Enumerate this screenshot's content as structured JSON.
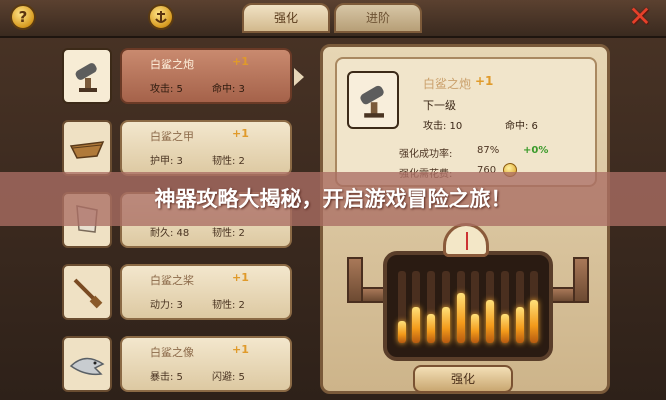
{
  "topbar": {
    "help_icon": "?",
    "tabs": [
      {
        "label": "强化",
        "active": true
      },
      {
        "label": "进阶",
        "active": false
      }
    ],
    "close_icon": "✕"
  },
  "items": [
    {
      "name": "白鲨之炮",
      "level": "+1",
      "stat1": "攻击: 5",
      "stat2": "命中: 3",
      "icon": "cannon-icon",
      "selected": true
    },
    {
      "name": "白鲨之甲",
      "level": "+1",
      "stat1": "护甲: 3",
      "stat2": "韧性: 2",
      "icon": "hull-icon",
      "selected": false
    },
    {
      "name": "",
      "level": "",
      "stat1": "耐久: 48",
      "stat2": "韧性: 2",
      "icon": "sail-icon",
      "selected": false
    },
    {
      "name": "白鲨之桨",
      "level": "+1",
      "stat1": "动力: 3",
      "stat2": "韧性: 2",
      "icon": "oar-icon",
      "selected": false
    },
    {
      "name": "白鲨之像",
      "level": "+1",
      "stat1": "暴击: 5",
      "stat2": "闪避: 5",
      "icon": "shark-icon",
      "selected": false
    }
  ],
  "detail": {
    "name": "白鲨之炮",
    "level": "+1",
    "next_label": "下一级",
    "stat1": "攻击: 10",
    "stat2": "命中: 6",
    "rate_label": "强化成功率:",
    "rate_value": "87%",
    "rate_bonus": "+0%",
    "cost_label": "强化需花费:",
    "cost_value": "760",
    "button": "强化"
  },
  "furnace": {
    "heat_levels": [
      0.3,
      0.5,
      0.4,
      0.5,
      0.7,
      0.4,
      0.6,
      0.4,
      0.5,
      0.6
    ]
  },
  "banner": "神器攻略大揭秘，开启游戏冒险之旅！"
}
